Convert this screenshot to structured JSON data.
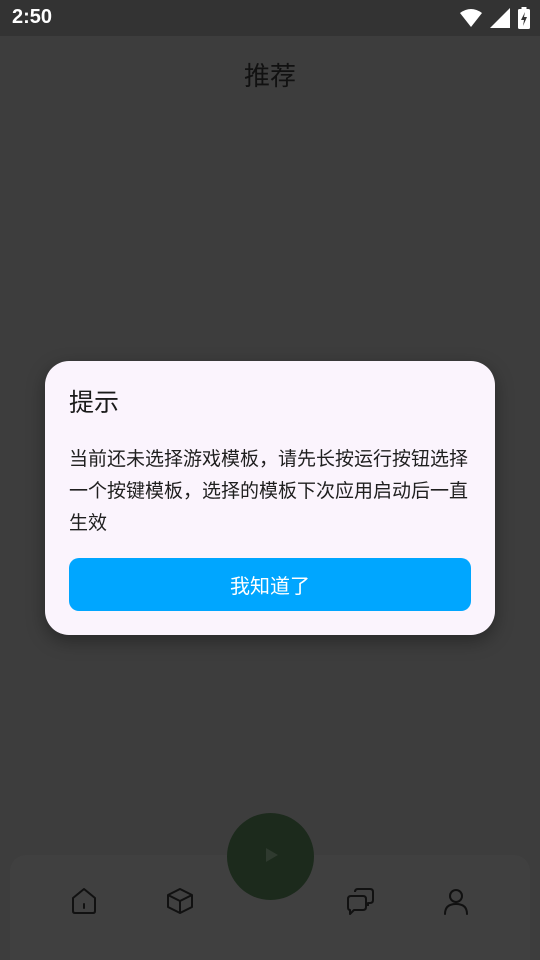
{
  "status_bar": {
    "time": "2:50",
    "icons": [
      "wifi-icon",
      "cellular-signal-icon",
      "battery-charging-icon"
    ]
  },
  "page": {
    "title": "推荐"
  },
  "dialog": {
    "title": "提示",
    "message": "当前还未选择游戏模板，请先长按运行按钮选择一个按键模板，选择的模板下次应用启动后一直生效",
    "confirm_label": "我知道了",
    "button_color": "#00a6ff",
    "background_color": "#fbf4fd"
  },
  "bottom_nav": {
    "items": [
      "home-icon",
      "cube-icon",
      "play-icon",
      "chat-icon",
      "profile-icon"
    ]
  }
}
